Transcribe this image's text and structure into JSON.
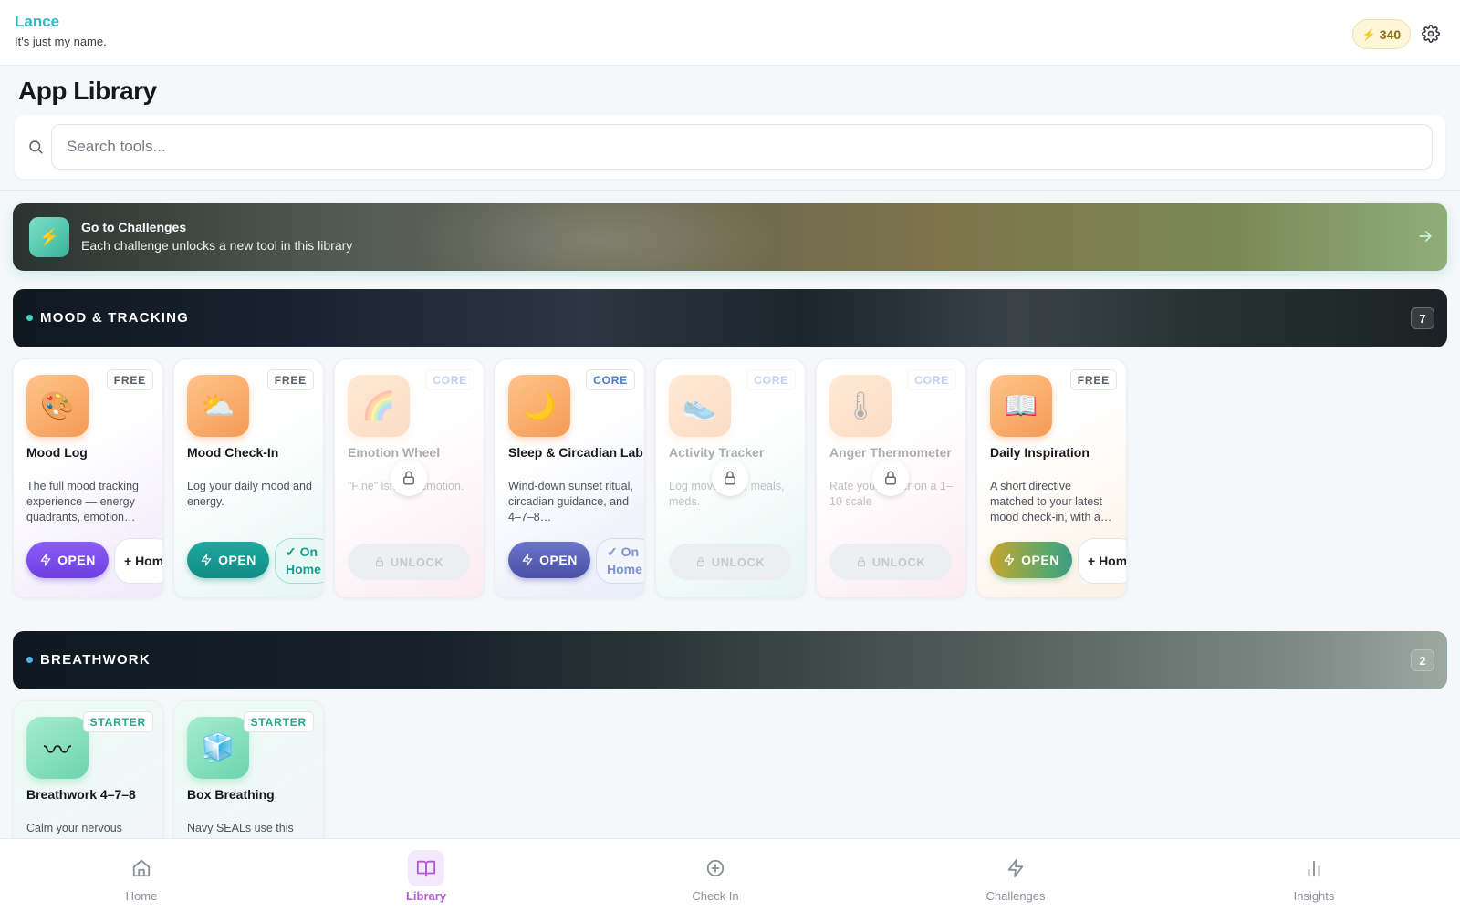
{
  "header": {
    "user_name": "Lance",
    "user_tagline": "It's just my name.",
    "points": "340"
  },
  "page": {
    "title": "App Library"
  },
  "search": {
    "placeholder": "Search tools..."
  },
  "challenge_banner": {
    "title": "Go to Challenges",
    "subtitle": "Each challenge unlocks a new tool in this library"
  },
  "categories": [
    {
      "title": "MOOD & TRACKING",
      "count": "7",
      "dot_color": "#3fd6c1",
      "tools": [
        {
          "name": "Mood Log",
          "badge": "FREE",
          "description": "The full mood tracking experience — energy quadrants, emotion…",
          "open_label": "OPEN",
          "home_label": "+ Home",
          "icon": "mood-log-icon"
        },
        {
          "name": "Mood Check-In",
          "badge": "FREE",
          "description": "Log your daily mood and energy.",
          "open_label": "OPEN",
          "home_label": "✓ On Home",
          "icon": "cloud-sun-icon"
        },
        {
          "name": "Emotion Wheel",
          "badge": "CORE",
          "description": "\"Fine\" isn't an emotion.",
          "unlock_label": "UNLOCK",
          "icon": "emotion-wheel-icon"
        },
        {
          "name": "Sleep & Circadian Lab",
          "badge": "CORE",
          "description": "Wind-down sunset ritual, circadian guidance, and 4–7–8…",
          "open_label": "OPEN",
          "home_label": "✓ On Home",
          "icon": "sleep-moon-icon"
        },
        {
          "name": "Activity Tracker",
          "badge": "CORE",
          "description": "Log movement, meals, meds.",
          "unlock_label": "UNLOCK",
          "icon": "sneaker-icon"
        },
        {
          "name": "Anger Thermometer",
          "badge": "CORE",
          "description": "Rate your anger on a 1–10 scale",
          "unlock_label": "UNLOCK",
          "icon": "thermometer-icon"
        },
        {
          "name": "Daily Inspiration",
          "badge": "FREE",
          "description": "A short directive matched to your latest mood check-in, with a…",
          "open_label": "OPEN",
          "home_label": "+ Home",
          "icon": "open-book-icon"
        }
      ]
    },
    {
      "title": "BREATHWORK",
      "count": "2",
      "dot_color": "#4fb0ee",
      "tools": [
        {
          "name": "Breathwork 4–7–8",
          "badge": "STARTER",
          "description": "Calm your nervous",
          "icon": "breath-waves-icon"
        },
        {
          "name": "Box Breathing",
          "badge": "STARTER",
          "description": "Navy SEALs use this",
          "icon": "box-breathing-icon"
        }
      ]
    }
  ],
  "nav": {
    "home": "Home",
    "library": "Library",
    "checkin": "Check In",
    "challenges": "Challenges",
    "insights": "Insights"
  },
  "colors": {
    "accent": "#35b7c8",
    "active_nav": "#b15bd6"
  }
}
